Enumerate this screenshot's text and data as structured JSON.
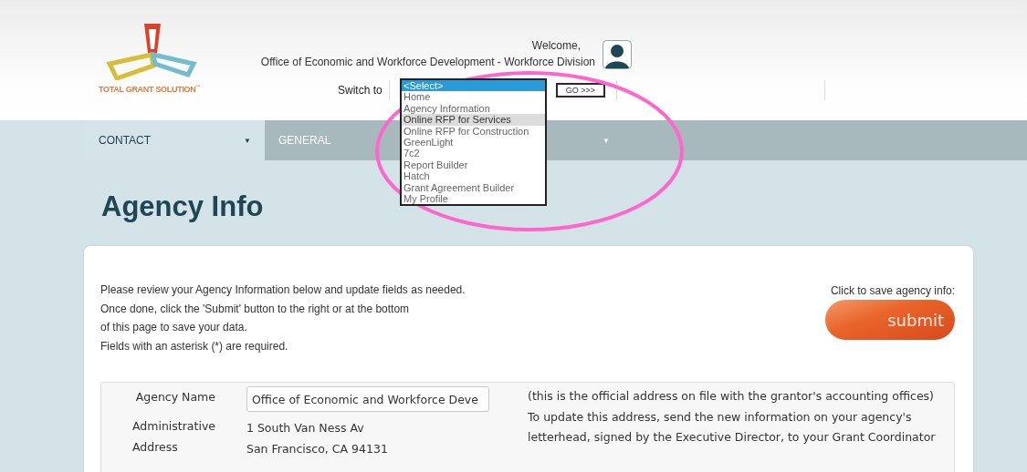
{
  "logo": {
    "text": "TOTAL GRANT SOLUTION",
    "mark": "™"
  },
  "header": {
    "welcome": "Welcome,",
    "organization": "Office of Economic and Workforce Development - Workforce Division",
    "switch_label": "Switch to",
    "go_button": "GO >>>"
  },
  "switch_options": [
    {
      "label": "<Select>",
      "selected": true,
      "hovered": false
    },
    {
      "label": "Home",
      "selected": false,
      "hovered": false
    },
    {
      "label": "Agency Information",
      "selected": false,
      "hovered": false
    },
    {
      "label": "Online RFP for Services",
      "selected": false,
      "hovered": true
    },
    {
      "label": "Online RFP for Construction",
      "selected": false,
      "hovered": false
    },
    {
      "label": "GreenLight",
      "selected": false,
      "hovered": false
    },
    {
      "label": "7c2",
      "selected": false,
      "hovered": false
    },
    {
      "label": "Report Builder",
      "selected": false,
      "hovered": false
    },
    {
      "label": "Hatch",
      "selected": false,
      "hovered": false
    },
    {
      "label": "Grant Agreement Builder",
      "selected": false,
      "hovered": false
    },
    {
      "label": "My Profile",
      "selected": false,
      "hovered": false
    }
  ],
  "nav_tabs": [
    {
      "label": "CONTACT",
      "selected": true,
      "caret": "▼"
    },
    {
      "label": "GENERAL",
      "selected": false,
      "caret": "▼"
    }
  ],
  "page_title": "Agency Info",
  "intro": [
    "Please review your Agency Information below and update fields as needed.",
    "Once done, click the 'Submit' button to the right or at the bottom",
    "of this page to save your data.",
    "Fields with an asterisk (*) are required."
  ],
  "save_hint": "Click to save agency info:",
  "submit_button": "submit",
  "form": {
    "agency_name_label": "Agency Name",
    "agency_name_value": "Office of Economic and Workforce Deve",
    "address_label": [
      "Administrative",
      "Address"
    ],
    "address_lines": [
      "1 South Van Ness Av",
      "San Francisco, CA 94131"
    ],
    "note": "(this is the official address on file with the grantor's accounting offices)\nTo update this address, send the new information on your agency's letterhead, signed by the Executive Director, to your Grant Coordinator"
  }
}
